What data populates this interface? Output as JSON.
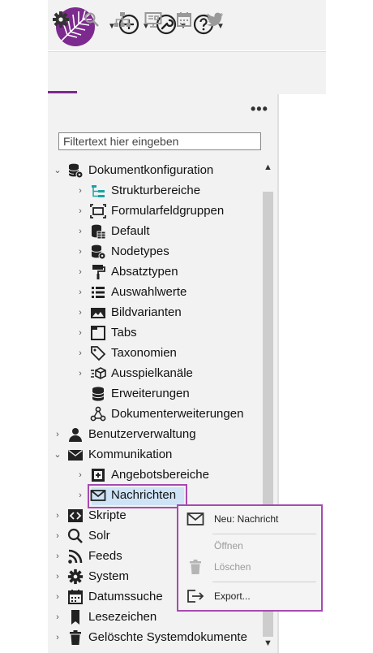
{
  "toolbar": {
    "create_icon": "plus-circle-icon",
    "tools_icon": "wrench-icon",
    "help_icon": "question-circle-icon"
  },
  "tabs": [
    {
      "name": "settings",
      "icon": "gear-icon",
      "active": true
    },
    {
      "name": "search",
      "icon": "search-icon"
    },
    {
      "name": "structure",
      "icon": "sitemap-icon"
    },
    {
      "name": "preview",
      "icon": "presentation-icon"
    },
    {
      "name": "calendar",
      "icon": "calendar-icon"
    },
    {
      "name": "twitter",
      "icon": "twitter-icon"
    }
  ],
  "panel": {
    "more_label": "•••"
  },
  "filter": {
    "placeholder": "Filtertext hier eingeben",
    "value": ""
  },
  "tree": {
    "dokumentkonfiguration": "Dokumentkonfiguration",
    "strukturbereiche": "Strukturbereiche",
    "formularfeldgruppen": "Formularfeldgruppen",
    "default": "Default",
    "nodetypes": "Nodetypes",
    "absatztypen": "Absatztypen",
    "auswahlwerte": "Auswahlwerte",
    "bildvarianten": "Bildvarianten",
    "tabs": "Tabs",
    "taxonomien": "Taxonomien",
    "ausspielkanaele": "Ausspielkanäle",
    "erweiterungen": "Erweiterungen",
    "dokumenterweiterungen": "Dokumenterweiterungen",
    "benutzerverwaltung": "Benutzerverwaltung",
    "kommunikation": "Kommunikation",
    "angebotsbereiche": "Angebotsbereiche",
    "nachrichten": "Nachrichten",
    "skripte": "Skripte",
    "solr": "Solr",
    "feeds": "Feeds",
    "system": "System",
    "datumssuche": "Datumssuche",
    "lesezeichen": "Lesezeichen",
    "geloeschte": "Gelöschte Systemdokumente"
  },
  "context_menu": {
    "new_message": "Neu: Nachricht",
    "open": "Öffnen",
    "delete": "Löschen",
    "export": "Export..."
  },
  "colors": {
    "brand": "#7d2a8e",
    "highlight_border": "#a64ab1",
    "selection": "#cfe3f6",
    "accent_teal": "#1aa3a3"
  }
}
